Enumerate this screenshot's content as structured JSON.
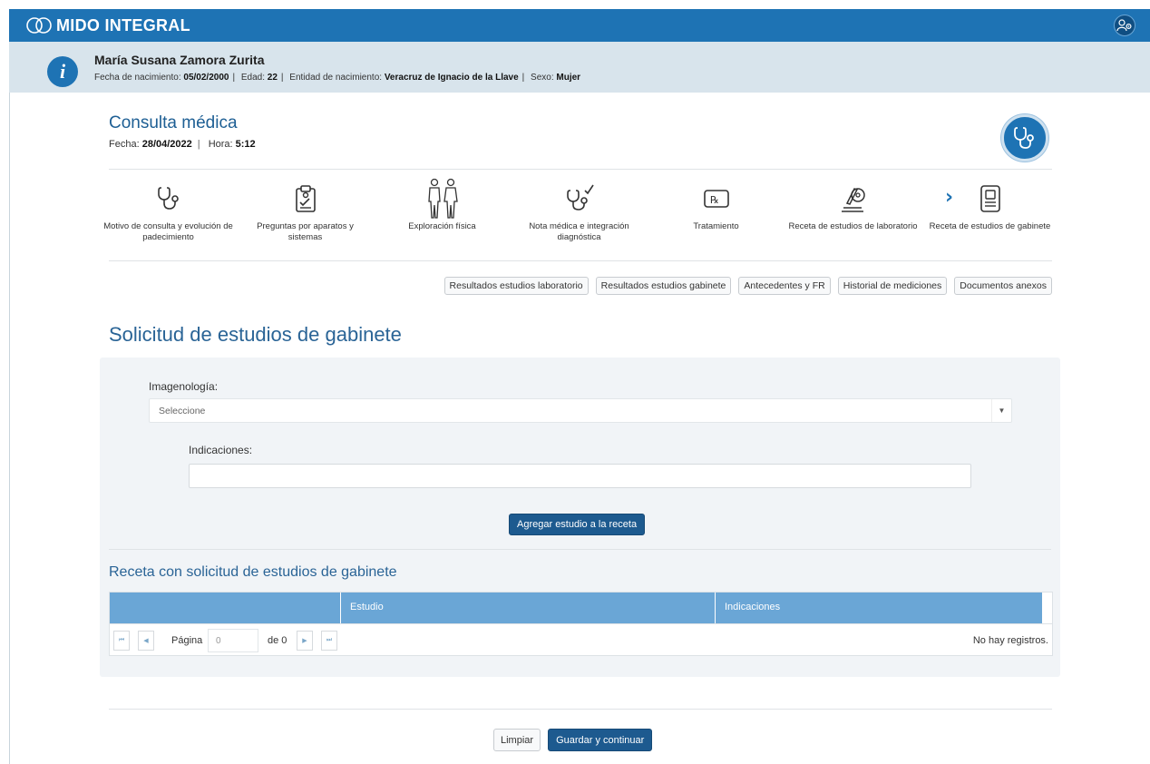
{
  "app": {
    "name": "MIDO INTEGRAL"
  },
  "patient": {
    "name": "María Susana Zamora Zurita",
    "birth_label": "Fecha de nacimiento:",
    "birth_value": "05/02/2000",
    "age_label": "Edad:",
    "age_value": "22",
    "entity_label": "Entidad de nacimiento:",
    "entity_value": "Veracruz de Ignacio de la Llave",
    "sex_label": "Sexo:",
    "sex_value": "Mujer"
  },
  "consult": {
    "title": "Consulta médica",
    "date_label": "Fecha:",
    "date_value": "28/04/2022",
    "time_label": "Hora:",
    "time_value": "5:12"
  },
  "steps": [
    {
      "label": "Motivo de consulta y evolución de padecimiento",
      "icon": "stethoscope-icon"
    },
    {
      "label": "Preguntas por aparatos y sistemas",
      "icon": "clipboard-icon"
    },
    {
      "label": "Exploración física",
      "icon": "body-figures-icon"
    },
    {
      "label": "Nota médica e integración diagnóstica",
      "icon": "stethoscope-check-icon"
    },
    {
      "label": "Tratamiento",
      "icon": "prescription-icon"
    },
    {
      "label": "Receta de estudios de laboratorio",
      "icon": "microscope-icon"
    },
    {
      "label": "Receta de estudios de gabinete",
      "icon": "document-icon",
      "active": true
    }
  ],
  "actions": [
    "Resultados estudios laboratorio",
    "Resultados estudios gabinete",
    "Antecedentes y FR",
    "Historial de mediciones",
    "Documentos anexos"
  ],
  "form": {
    "title": "Solicitud de estudios de gabinete",
    "imaging_label": "Imagenología:",
    "imaging_placeholder": "Seleccione",
    "indications_label": "Indicaciones:",
    "indications_value": "",
    "add_button": "Agregar estudio a la receta"
  },
  "recipe": {
    "title": "Receta con solicitud de estudios de gabinete",
    "columns": [
      "",
      "Estudio",
      "Indicaciones"
    ],
    "page_label": "Página",
    "page_value": "0",
    "page_of": "de 0",
    "empty_text": "No hay registros."
  },
  "footer": {
    "clear_button": "Limpiar",
    "save_button": "Guardar y continuar"
  },
  "colors": {
    "brand": "#1e73b4",
    "patient_bar": "#d8e4ec",
    "primary_button": "#1d5a8f",
    "grid_header": "#6aa6d6",
    "panel": "#f1f4f7"
  }
}
